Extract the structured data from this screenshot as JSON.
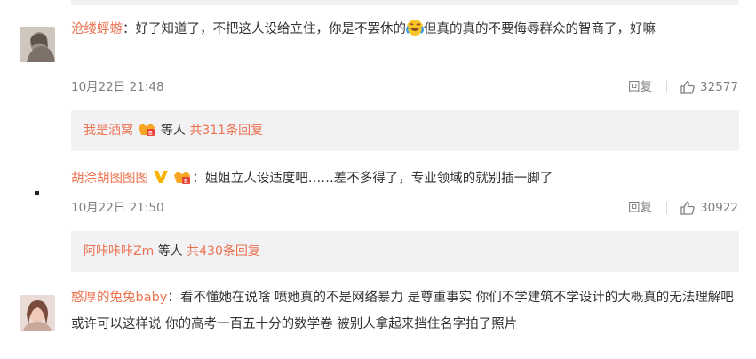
{
  "comments": [
    {
      "user": "沧缕蜉蝣",
      "text_before": "好了知道了，不把这人设给立住，你是不罢休的",
      "emoji": "crying-laugh-emoji",
      "text_after": "但真的真的不要侮辱群众的智商了，好嘛",
      "time": "10月22日 21:48",
      "reply_label": "回复",
      "likes": "32577"
    },
    {
      "user": "胡涂胡图图图",
      "text": "姐姐立人设适度吧……差不多得了，专业领域的就别插一脚了",
      "time": "10月22日 21:50",
      "reply_label": "回复",
      "likes": "30922"
    },
    {
      "user": "憨厚的兔兔baby",
      "text": "看不懂她在说啥 喷她真的不是网络暴力 是尊重事实 你们不学建筑不学设计的大概真的无法理解吧 或许可以这样说 你的高考一百五十分的数学卷 被别人拿起来挡住名字拍了照片"
    }
  ],
  "sub_threads": [
    {
      "name": "我是酒窝",
      "mid": "等人",
      "count": "共311条回复"
    },
    {
      "name": "阿咔咔咔Zm",
      "mid": "等人",
      "count": "共430条回复"
    }
  ],
  "colon": "：",
  "colors": {
    "username": "#eb7350",
    "meta": "#808080",
    "subbox": "#f2f2f5"
  }
}
